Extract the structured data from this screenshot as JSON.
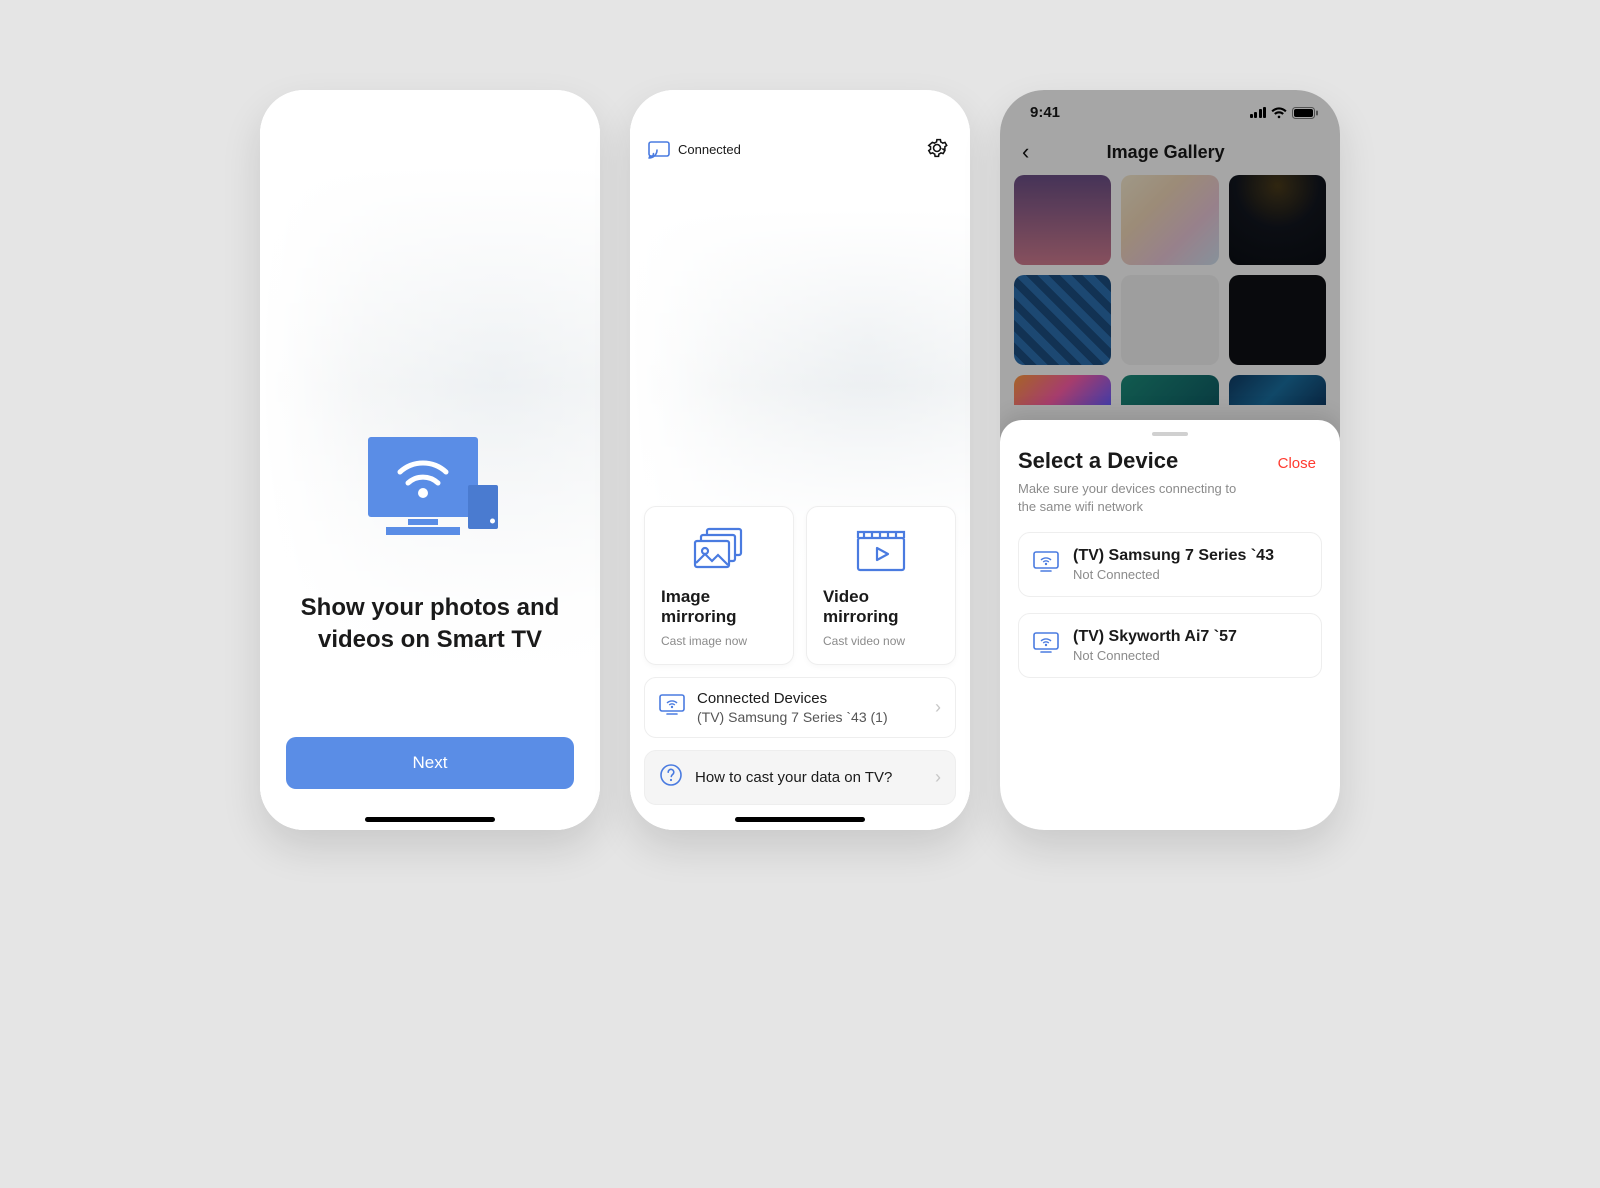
{
  "status": {
    "time": "9:41"
  },
  "screen1": {
    "title": "Show your photos and videos on Smart TV",
    "next_label": "Next"
  },
  "screen2": {
    "connected_label": "Connected",
    "image_card": {
      "title": "Image mirroring",
      "subtitle": "Cast image now"
    },
    "video_card": {
      "title": "Video mirroring",
      "subtitle": "Cast video now"
    },
    "connected": {
      "title": "Connected Devices",
      "subtitle": "(TV) Samsung 7 Series `43 (1)"
    },
    "howto": {
      "title": "How to cast your data on TV?"
    }
  },
  "screen3": {
    "title": "Image Gallery",
    "sheet": {
      "title": "Select a Device",
      "close_label": "Close",
      "hint": "Make sure your devices connecting to the same wifi network",
      "devices": [
        {
          "name": "(TV) Samsung 7 Series `43",
          "status": "Not Connected"
        },
        {
          "name": "(TV) Skyworth Ai7 `57",
          "status": "Not Connected"
        }
      ]
    }
  }
}
